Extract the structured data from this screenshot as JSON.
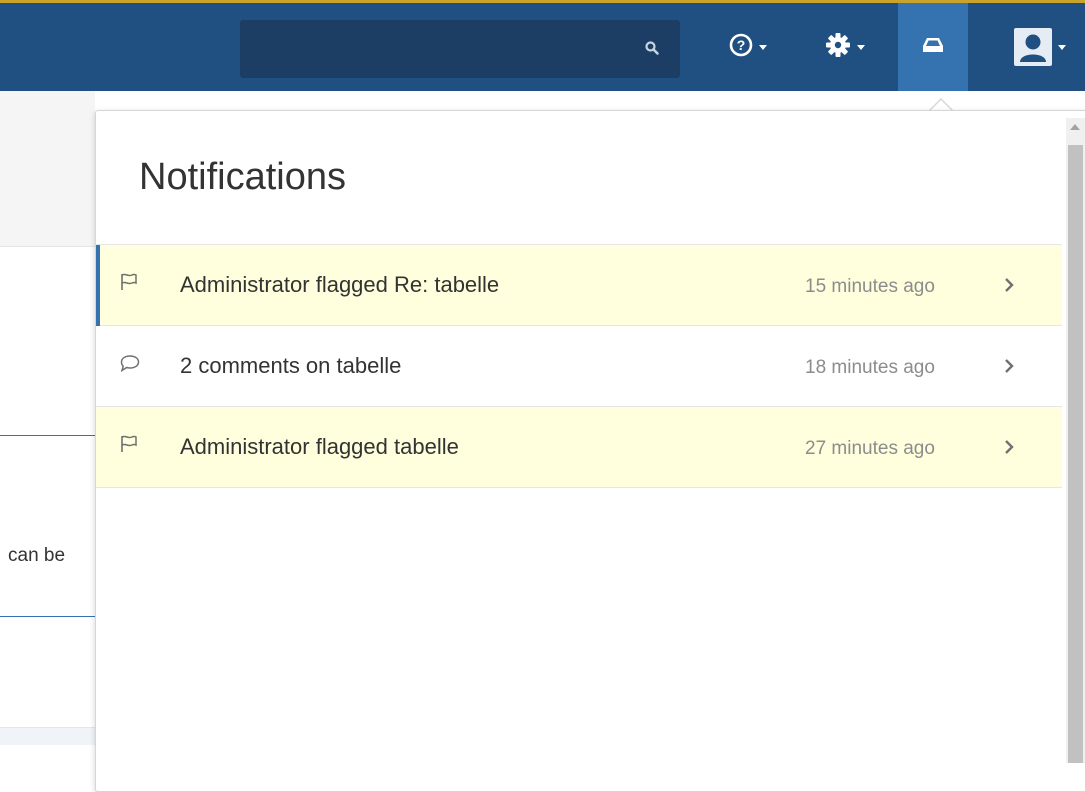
{
  "header": {
    "search": {
      "placeholder": "",
      "value": "",
      "icon": "search-icon"
    },
    "help_icon": "help-icon",
    "settings_icon": "gear-icon",
    "notifications_icon": "inbox-icon",
    "user_icon": "user-avatar-icon"
  },
  "background": {
    "text_fragment": "can be"
  },
  "notifications": {
    "title": "Notifications",
    "items": [
      {
        "icon": "flag-icon",
        "text": "Administrator flagged Re: tabelle",
        "time": "15 minutes ago",
        "unread": true
      },
      {
        "icon": "comment-icon",
        "text": "2 comments on tabelle",
        "time": "18 minutes ago",
        "unread": false
      },
      {
        "icon": "flag-icon",
        "text": "Administrator flagged tabelle",
        "time": "27 minutes ago",
        "unread": true
      }
    ]
  },
  "colors": {
    "header_bg": "#205081",
    "header_accent": "#c9a32a",
    "active_button": "#3572b0",
    "unread_row": "#ffffdd",
    "link_blue": "#3572b0"
  }
}
